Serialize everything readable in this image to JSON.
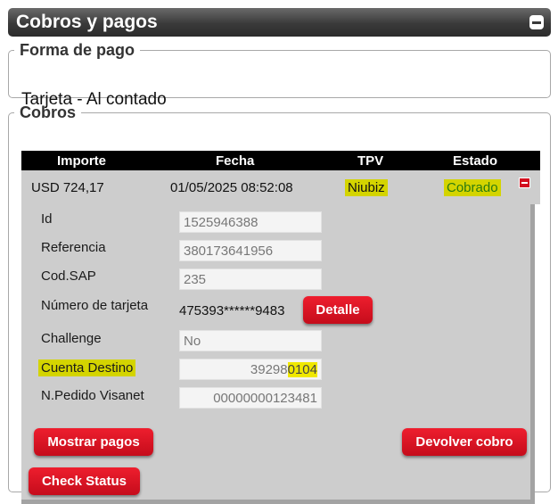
{
  "panel": {
    "title": "Cobros y pagos"
  },
  "forma_pago": {
    "legend": "Forma de pago",
    "value": "Tarjeta - Al contado"
  },
  "cobros": {
    "legend": "Cobros",
    "columns": [
      "Importe",
      "Fecha",
      "TPV",
      "Estado"
    ],
    "row": {
      "importe": "USD 724,17",
      "fecha": "01/05/2025 08:52:08",
      "tpv": "Niubiz",
      "estado": "Cobrado"
    },
    "detail": {
      "id_label": "Id",
      "id_value": "1525946388",
      "referencia_label": "Referencia",
      "referencia_value": "380173641956",
      "codsap_label": "Cod.SAP",
      "codsap_value": "235",
      "tarjeta_label": "Número de tarjeta",
      "tarjeta_value": "475393******9483",
      "detalle_button": "Detalle",
      "challenge_label": "Challenge",
      "challenge_value": "No",
      "cuenta_label": "Cuenta Destino",
      "cuenta_value_plain": "39298",
      "cuenta_value_highlight": "0104",
      "pedido_label": "N.Pedido Visanet",
      "pedido_value": "00000000123481"
    },
    "buttons": {
      "mostrar_pagos": "Mostrar pagos",
      "devolver_cobro": "Devolver cobro",
      "check_status": "Check Status"
    }
  },
  "colors": {
    "accent_red": "#d30f1f",
    "highlight_yellow": "#d4d400",
    "estado_green": "#2a7a10",
    "header_black": "#000000"
  }
}
